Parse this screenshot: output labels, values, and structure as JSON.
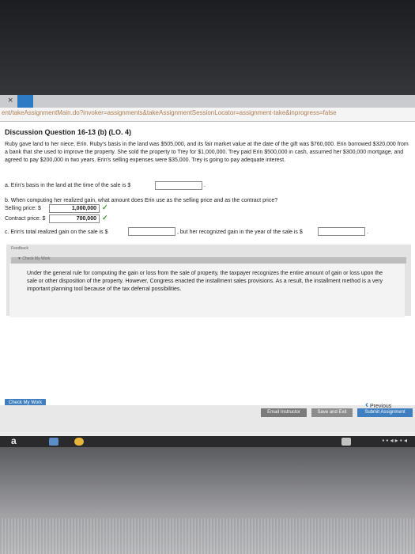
{
  "browser": {
    "tab_close": "×",
    "url": "ent/takeAssignmentMain.do?invoker=assignments&takeAssignmentSessionLocator=assignment-take&inprogress=false"
  },
  "question": {
    "title": "Discussion Question 16-13 (b) (LO. 4)",
    "body": "Ruby gave land to her niece, Erin. Ruby's basis in the land was $505,000, and its fair market value at the date of the gift was $760,000. Erin borrowed $320,000 from a bank that she used to improve the property. She sold the property to Trey for $1,000,000. Trey paid Erin $500,000 in cash, assumed her $300,000 mortgage, and agreed to pay $200,000 in two years. Erin's selling expenses were $35,000. Trey is going to pay adequate interest.",
    "a_label": "a.  Erin's basis in the land at the time of the sale is $",
    "a_value": "",
    "b_label": "b.  When computing her realized gain, what amount does Erin use as the selling price and as the contract price?",
    "selling_label": "Selling price: $",
    "selling_value": "1,000,000",
    "contract_label": "Contract price: $",
    "contract_value": "700,000",
    "c_label": "c.  Erin's total realized gain on the sale is $",
    "c_value": "",
    "c_mid": ", but her recognized gain in the year of the sale is $",
    "c_value2": "",
    "period": "."
  },
  "feedback": {
    "label": "Feedback",
    "check_my_work": "▼ Check My Work",
    "text": "Under the general rule for computing the gain or loss from the sale of property, the taxpayer recognizes the entire amount of gain or loss upon the sale or other disposition of the property. However, Congress enacted the installment sales provisions. As a result, the installment method is a very important planning tool because of the tax deferral possibilities."
  },
  "buttons": {
    "check_my_work": "Check My Work",
    "previous": "Previous",
    "email_instructor": "Email Instructor",
    "save_and_exit": "Save and Exit",
    "submit": "Submit Assignment"
  },
  "taskbar": {
    "app_letter": "a",
    "tray": "▪ ▪ ◂ ▸ ▪ ◂"
  },
  "colors": {
    "primary_button": "#3f7fbf",
    "email_button": "#7a7a7a",
    "submit_button": "#3f7fbf",
    "check_mark": "#3f8f2a"
  }
}
